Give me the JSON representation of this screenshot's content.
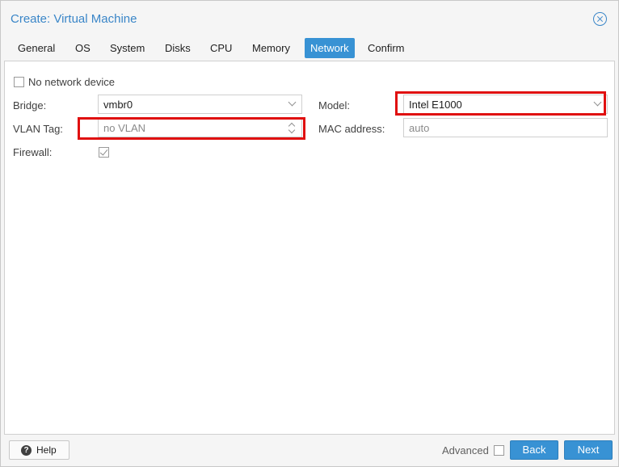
{
  "dialog": {
    "title": "Create: Virtual Machine"
  },
  "tabs": [
    {
      "label": "General"
    },
    {
      "label": "OS"
    },
    {
      "label": "System"
    },
    {
      "label": "Disks"
    },
    {
      "label": "CPU"
    },
    {
      "label": "Memory"
    },
    {
      "label": "Network",
      "active": true
    },
    {
      "label": "Confirm"
    }
  ],
  "network": {
    "no_device_label": "No network device",
    "no_device_checked": false,
    "bridge_label": "Bridge:",
    "bridge_value": "vmbr0",
    "vlan_label": "VLAN Tag:",
    "vlan_placeholder": "no VLAN",
    "firewall_label": "Firewall:",
    "firewall_checked": true,
    "model_label": "Model:",
    "model_value": "Intel E1000",
    "mac_label": "MAC address:",
    "mac_placeholder": "auto"
  },
  "footer": {
    "help_label": "Help",
    "advanced_label": "Advanced",
    "advanced_checked": false,
    "back_label": "Back",
    "next_label": "Next"
  },
  "colors": {
    "accent": "#3892d4",
    "title": "#3a86c8",
    "highlight": "#e01010"
  },
  "icons": {
    "close": "close-icon",
    "help": "help-icon",
    "dropdown": "chevron-down-icon",
    "spinner": "spinner-icon"
  }
}
